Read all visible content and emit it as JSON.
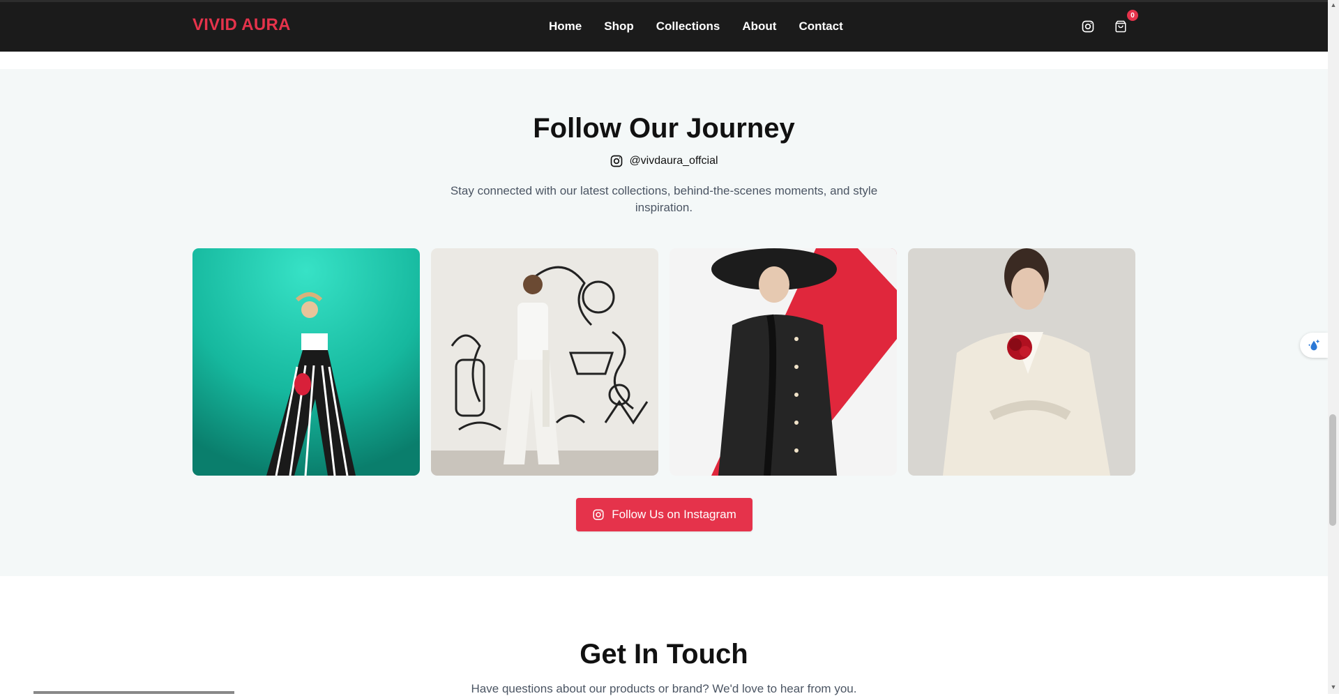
{
  "header": {
    "logo": "VIVID AURA",
    "nav": [
      "Home",
      "Shop",
      "Collections",
      "About",
      "Contact"
    ],
    "cart_count": "0",
    "icons": [
      "instagram-icon",
      "cart-icon"
    ]
  },
  "follow": {
    "title": "Follow Our Journey",
    "handle": "@vivdaura_offcial",
    "description": "Stay connected with our latest collections, behind-the-scenes moments, and style inspiration.",
    "button_label": "Follow Us on Instagram"
  },
  "contact": {
    "title": "Get In Touch",
    "subtitle": "Have questions about our products or brand? We'd love to hear from you."
  },
  "colors": {
    "accent": "#e5334b",
    "header_bg": "#1b1b1b",
    "section_bg": "#f4f8f8"
  }
}
